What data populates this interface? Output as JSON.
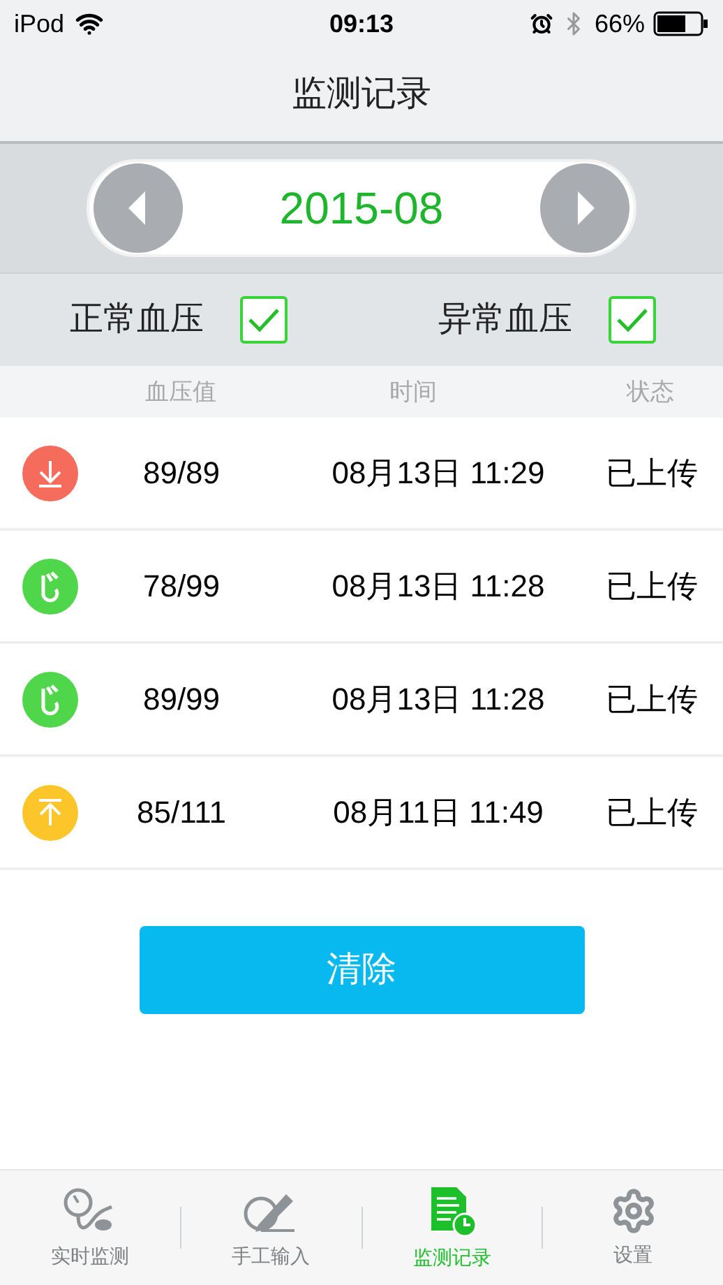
{
  "status_bar": {
    "device": "iPod",
    "time": "09:13",
    "battery": "66%"
  },
  "title": "监测记录",
  "month": {
    "label": "2015-08"
  },
  "filters": [
    {
      "label": "正常血压",
      "checked": true
    },
    {
      "label": "异常血压",
      "checked": true
    }
  ],
  "table": {
    "columns": [
      "血压值",
      "时间",
      "状态"
    ],
    "rows": [
      {
        "kind": "low",
        "color": "#f56b5c",
        "value": "89/89",
        "time": "08月13日 11:29",
        "status": "已上传"
      },
      {
        "kind": "normal",
        "color": "#4fd64a",
        "value": "78/99",
        "time": "08月13日 11:28",
        "status": "已上传"
      },
      {
        "kind": "normal",
        "color": "#4fd64a",
        "value": "89/99",
        "time": "08月13日 11:28",
        "status": "已上传"
      },
      {
        "kind": "high",
        "color": "#fcc52a",
        "value": "85/111",
        "time": "08月11日 11:49",
        "status": "已上传"
      }
    ]
  },
  "clear_button": "清除",
  "tabs": [
    {
      "kind": "gauge",
      "label": "实时监测",
      "selected": false
    },
    {
      "kind": "pencil",
      "label": "手工输入",
      "selected": false
    },
    {
      "kind": "record",
      "label": "监测记录",
      "selected": true
    },
    {
      "kind": "gear",
      "label": "设置",
      "selected": false
    }
  ]
}
